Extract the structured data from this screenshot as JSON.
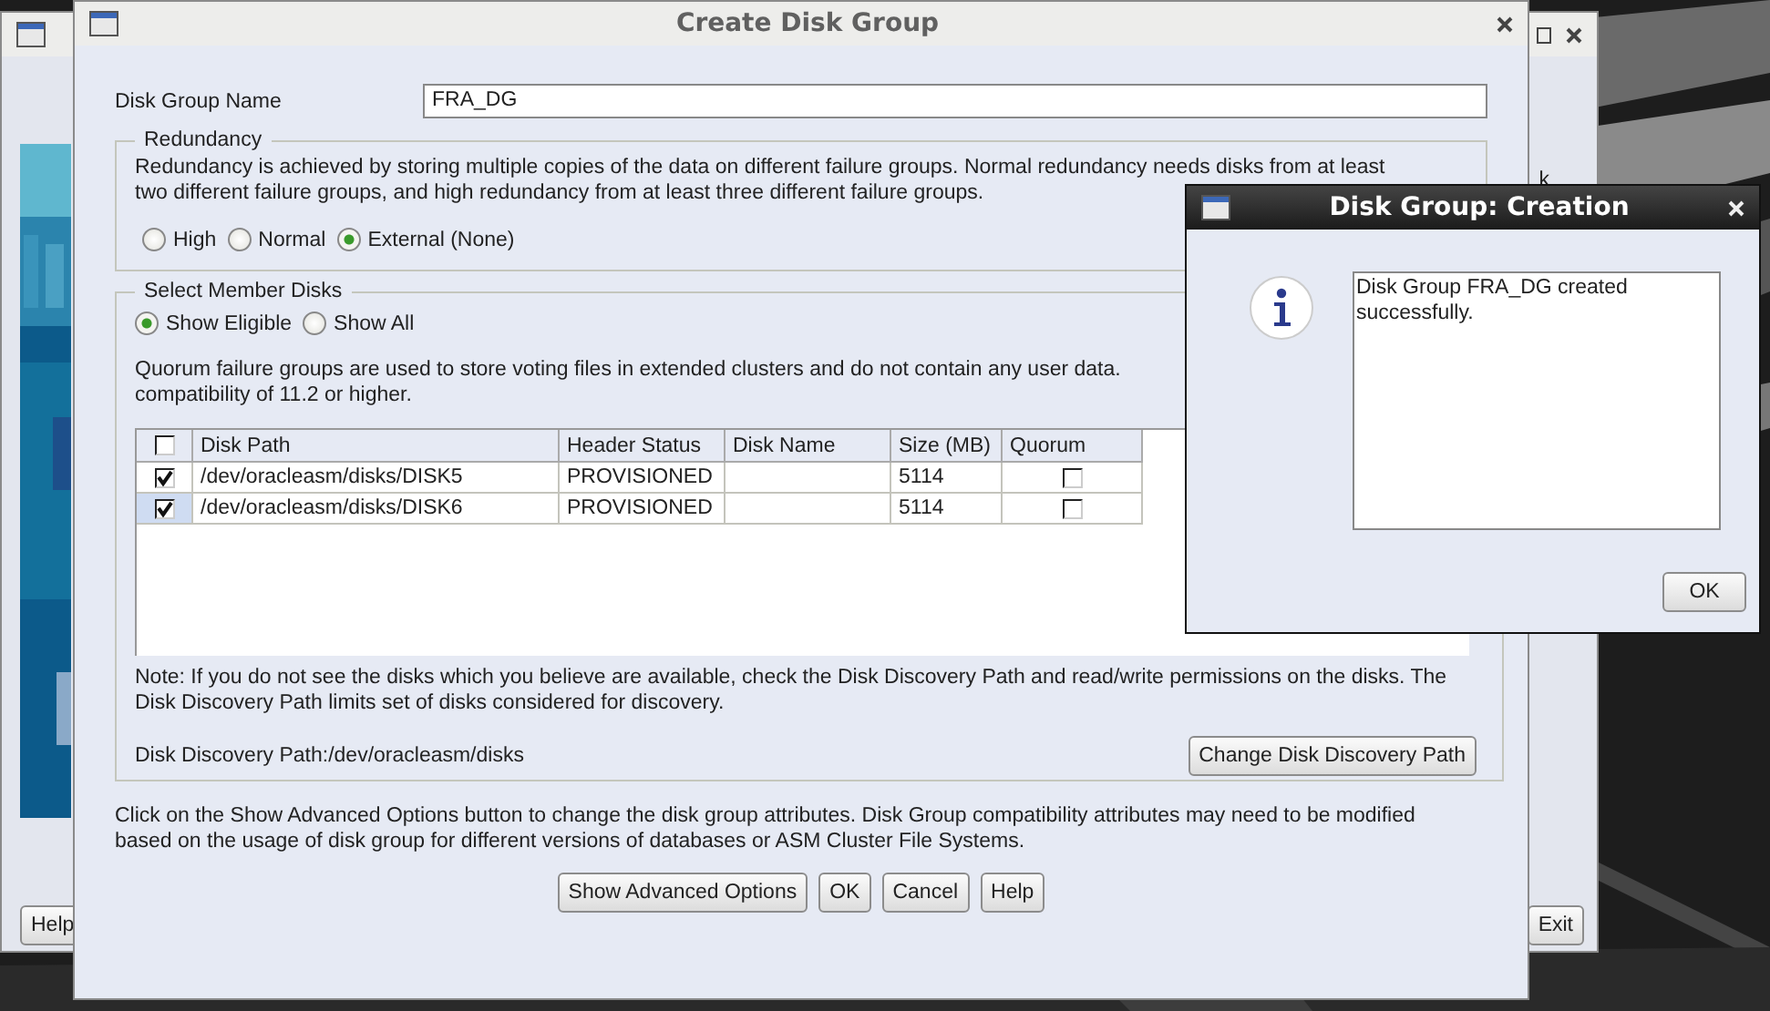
{
  "back_window": {
    "fragment_text": "k",
    "buttons": [
      {
        "label": "Help",
        "kind": "left"
      },
      {
        "label": "Exit",
        "kind": "right"
      }
    ]
  },
  "dialog": {
    "title": "Create Disk Group",
    "name_field": {
      "label": "Disk Group Name",
      "value": "FRA_DG"
    },
    "redundancy": {
      "legend": "Redundancy",
      "description": "Redundancy is achieved by storing multiple copies of the data on different failure groups. Normal redundancy needs disks from at least",
      "description_line2": "two different failure groups, and high redundancy from at least three different failure groups.",
      "options": [
        {
          "label": "High",
          "selected": false
        },
        {
          "label": "Normal",
          "selected": false
        },
        {
          "label": "External (None)",
          "selected": true
        }
      ]
    },
    "member_disks": {
      "legend": "Select Member Disks",
      "filters": [
        {
          "label": "Show Eligible",
          "selected": true
        },
        {
          "label": "Show All",
          "selected": false
        }
      ],
      "quorum_note": "Quorum failure groups are used to store voting files in extended clusters and do not contain any user data.",
      "quorum_note_line2": "compatibility of 11.2 or higher.",
      "table": {
        "select_all_checked": false,
        "columns": [
          "Disk Path",
          "Header Status",
          "Disk Name",
          "Size (MB)",
          "Quorum"
        ],
        "rows": [
          {
            "checked": true,
            "selected": false,
            "disk_path": "/dev/oracleasm/disks/DISK5",
            "header_status": "PROVISIONED",
            "disk_name": "",
            "size": "5114",
            "quorum": false
          },
          {
            "checked": true,
            "selected": true,
            "disk_path": "/dev/oracleasm/disks/DISK6",
            "header_status": "PROVISIONED",
            "disk_name": "",
            "size": "5114",
            "quorum": false
          }
        ]
      },
      "note": "Note: If you do not see the disks which you believe are available, check the Disk Discovery Path and read/write permissions on the disks. The Disk Discovery Path limits set of disks considered for discovery.",
      "discovery_path": "Disk Discovery Path:/dev/oracleasm/disks",
      "change_button": "Change Disk Discovery Path"
    },
    "advanced_note": "Click on the Show Advanced Options button to change the disk group attributes. Disk Group compatibility attributes may need to be modified based on the usage of disk group for different versions of databases or ASM Cluster File Systems.",
    "buttons": [
      "Show Advanced Options",
      "OK",
      "Cancel",
      "Help"
    ]
  },
  "popup": {
    "title": "Disk Group: Creation",
    "message": "Disk Group FRA_DG created successfully.",
    "button": "OK"
  }
}
